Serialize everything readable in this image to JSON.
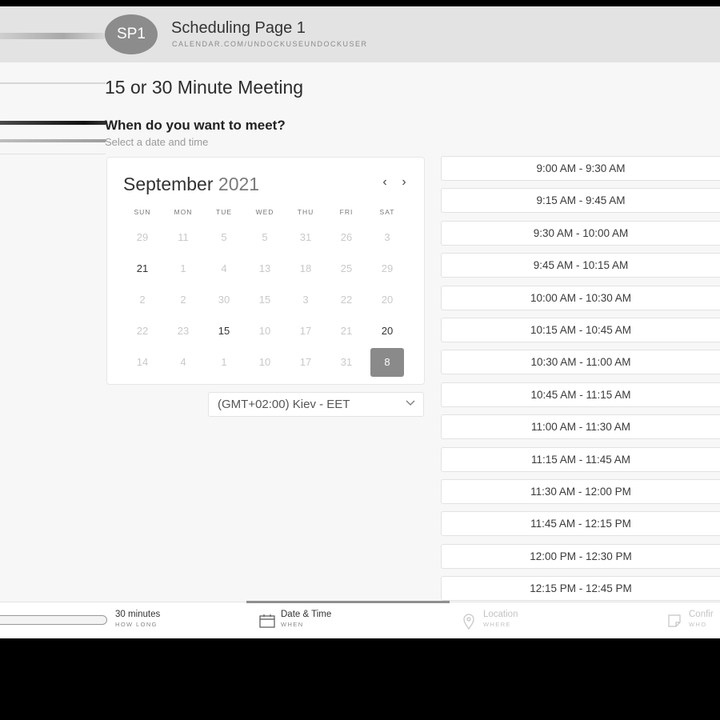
{
  "header": {
    "avatar_initials": "SP1",
    "title": "Scheduling Page 1",
    "url": "CALENDAR.COM/UNDOCKUSEUNDOCKUSER"
  },
  "main": {
    "meeting_title": "15 or 30 Minute Meeting",
    "question": "When do you want to meet?",
    "subtext": "Select a date and time"
  },
  "calendar": {
    "month": "September",
    "year": "2021",
    "prev": "‹",
    "next": "›",
    "weekdays": [
      "SUN",
      "MON",
      "TUE",
      "WED",
      "THU",
      "FRI",
      "SAT"
    ],
    "weeks": [
      [
        "29",
        "11",
        "5",
        "5",
        "31",
        "26",
        "3"
      ],
      [
        "21",
        "1",
        "4",
        "13",
        "18",
        "25",
        "29"
      ],
      [
        "2",
        "2",
        "30",
        "15",
        "3",
        "22",
        "20"
      ],
      [
        "22",
        "23",
        "15",
        "10",
        "17",
        "21",
        "20"
      ],
      [
        "14",
        "4",
        "1",
        "10",
        "17",
        "31",
        "8"
      ]
    ],
    "strong_days": [
      [
        1,
        0
      ],
      [
        3,
        2
      ],
      [
        3,
        6
      ]
    ],
    "selected_day": [
      4,
      6
    ]
  },
  "timezone": {
    "value": "(GMT+02:00) Kiev - EET"
  },
  "time_slots": [
    "9:00 AM - 9:30 AM",
    "9:15 AM - 9:45 AM",
    "9:30 AM - 10:00 AM",
    "9:45 AM - 10:15 AM",
    "10:00 AM - 10:30 AM",
    "10:15 AM - 10:45 AM",
    "10:30 AM - 11:00 AM",
    "10:45 AM - 11:15 AM",
    "11:00 AM - 11:30 AM",
    "11:15 AM - 11:45 AM",
    "11:30 AM - 12:00 PM",
    "11:45 AM - 12:15 PM",
    "12:00 PM - 12:30 PM",
    "12:15 PM - 12:45 PM"
  ],
  "steps": {
    "duration": {
      "label": "30 minutes",
      "sub": "HOW LONG"
    },
    "datetime": {
      "label": "Date & Time",
      "sub": "WHEN"
    },
    "location": {
      "label": "Location",
      "sub": "WHERE"
    },
    "confirm": {
      "label": "Confir",
      "sub": "WHO"
    }
  },
  "icons": {
    "datetime": "calendar-icon",
    "location": "location-pin-icon",
    "confirm": "note-icon",
    "tz": "chevron-down-icon"
  },
  "colors": {
    "selected": "#8a8a8a",
    "header_bg": "#e3e3e3"
  }
}
